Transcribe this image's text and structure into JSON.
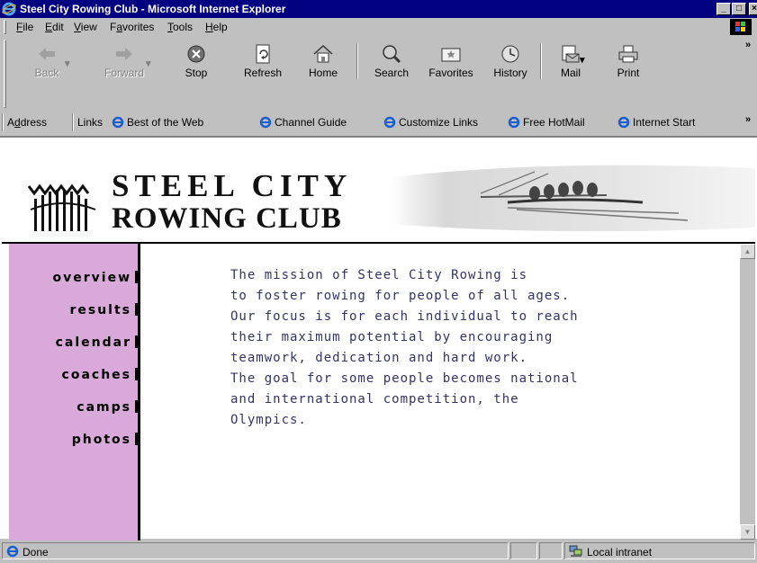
{
  "window": {
    "title": "Steel City Rowing Club - Microsoft Internet Explorer",
    "controls": {
      "minimize": "_",
      "maximize": "□",
      "close": "×"
    }
  },
  "menu": {
    "items": [
      {
        "label": "File",
        "key": "F",
        "rest": "ile"
      },
      {
        "label": "Edit",
        "key": "E",
        "rest": "dit"
      },
      {
        "label": "View",
        "key": "V",
        "rest": "iew"
      },
      {
        "label": "Favorites",
        "key": "a",
        "pre": "F",
        "rest": "vorites"
      },
      {
        "label": "Tools",
        "key": "T",
        "rest": "ools"
      },
      {
        "label": "Help",
        "key": "H",
        "rest": "elp"
      }
    ]
  },
  "toolbar": {
    "back": "Back",
    "forward": "Forward",
    "stop": "Stop",
    "refresh": "Refresh",
    "home": "Home",
    "search": "Search",
    "favorites": "Favorites",
    "history": "History",
    "mail": "Mail",
    "print": "Print",
    "more": "»"
  },
  "linksbar": {
    "address_label": "Address",
    "address_key": "d",
    "links_label": "Links",
    "links": [
      "Best of the Web",
      "Channel Guide",
      "Customize Links",
      "Free HotMail",
      "Internet Start"
    ],
    "more": "»"
  },
  "page": {
    "logo_line1": "STEEL CITY",
    "logo_line2": "ROWING CLUB",
    "nav": [
      "overview",
      "results",
      "calendar",
      "coaches",
      "camps",
      "photos"
    ],
    "mission_lines": [
      "The mission of Steel City Rowing is",
      "to foster rowing for people of all ages.",
      "Our focus is for each individual to reach",
      "their maximum potential by encouraging",
      "teamwork, dedication and hard work.",
      "The goal for some people becomes national",
      "and international competition, the",
      "Olympics."
    ],
    "colors": {
      "sidebar": "#d9a9d9",
      "mission_text": "#333366"
    }
  },
  "status": {
    "text": "Done",
    "zone": "Local intranet"
  }
}
